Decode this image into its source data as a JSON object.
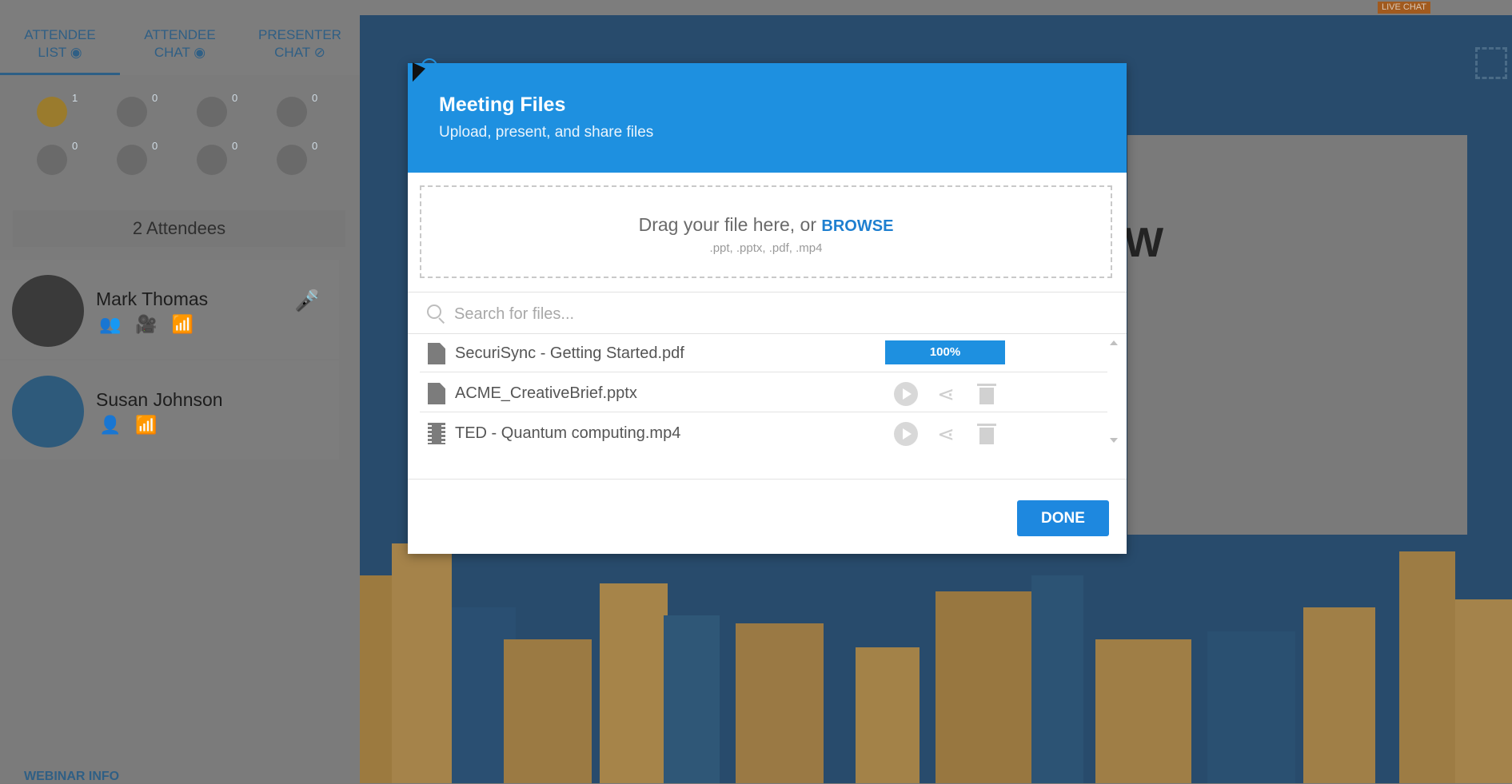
{
  "topbar": {
    "live_chat": "LIVE CHAT"
  },
  "sidebar": {
    "tabs": [
      {
        "line1": "ATTENDEE",
        "line2": "LIST",
        "icon": "eye-icon"
      },
      {
        "line1": "ATTENDEE",
        "line2": "CHAT",
        "icon": "eye-icon"
      },
      {
        "line1": "PRESENTER",
        "line2": "CHAT",
        "icon": "eye-slash-icon"
      }
    ],
    "reactions": [
      {
        "icon": "smile-icon",
        "count": "1"
      },
      {
        "icon": "thumbs-up-icon",
        "count": "0"
      },
      {
        "icon": "thumbs-down-icon",
        "count": "0"
      },
      {
        "icon": "heart-eyes-icon",
        "count": "0"
      },
      {
        "icon": "sad-icon",
        "count": "0"
      },
      {
        "icon": "laughing-icon",
        "count": "0"
      },
      {
        "icon": "surprised-icon",
        "count": "0"
      },
      {
        "icon": "clap-icon",
        "count": "0"
      }
    ],
    "attendee_count": "2 Attendees",
    "attendees": [
      {
        "name": "Mark Thomas"
      },
      {
        "name": "Susan Johnson"
      }
    ],
    "webinar_info": "WEBINAR INFO"
  },
  "stage": {
    "slide_letter": "W"
  },
  "modal": {
    "title": "Meeting Files",
    "subtitle": "Upload, present, and share files",
    "drop_text": "Drag your file here, or",
    "browse_label": "BROWSE",
    "file_types": ".ppt, .pptx, .pdf, .mp4",
    "search_placeholder": "Search for files...",
    "files": [
      {
        "name": "SecuriSync - Getting Started.pdf",
        "type": "doc",
        "progress": 100,
        "progress_label": "100%"
      },
      {
        "name": "ACME_CreativeBrief.pptx",
        "type": "doc"
      },
      {
        "name": "TED - Quantum computing.mp4",
        "type": "video"
      }
    ],
    "done_label": "DONE"
  },
  "colors": {
    "accent": "#1e90e0",
    "button": "#1e88df"
  }
}
